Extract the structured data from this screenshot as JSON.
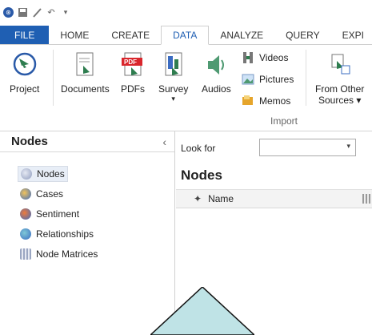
{
  "qat": {
    "icons": [
      "app-icon",
      "save-icon",
      "edit-icon",
      "undo-icon",
      "customize-icon"
    ]
  },
  "ribbon_tabs": [
    "FILE",
    "HOME",
    "CREATE",
    "DATA",
    "ANALYZE",
    "QUERY",
    "EXPI"
  ],
  "active_tab": "DATA",
  "ribbon": {
    "project": "Project",
    "documents": "Documents",
    "pdfs": "PDFs",
    "survey": "Survey",
    "survey_arrow": "▾",
    "audios": "Audios",
    "videos": "Videos",
    "pictures": "Pictures",
    "memos": "Memos",
    "from_other_1": "From Other",
    "from_other_2": "Sources ▾",
    "group_import": "Import"
  },
  "leftnav": {
    "title": "Nodes",
    "collapse": "‹",
    "items": [
      "Nodes",
      "Cases",
      "Sentiment",
      "Relationships",
      "Node Matrices"
    ]
  },
  "main": {
    "look_for_label": "Look for",
    "look_for_value": "",
    "title": "Nodes",
    "column_name": "Name"
  },
  "colors": {
    "file_tab": "#1f5fb3",
    "active_tab_text": "#1f5fb3",
    "triangle_fill": "#bfe3e6"
  }
}
